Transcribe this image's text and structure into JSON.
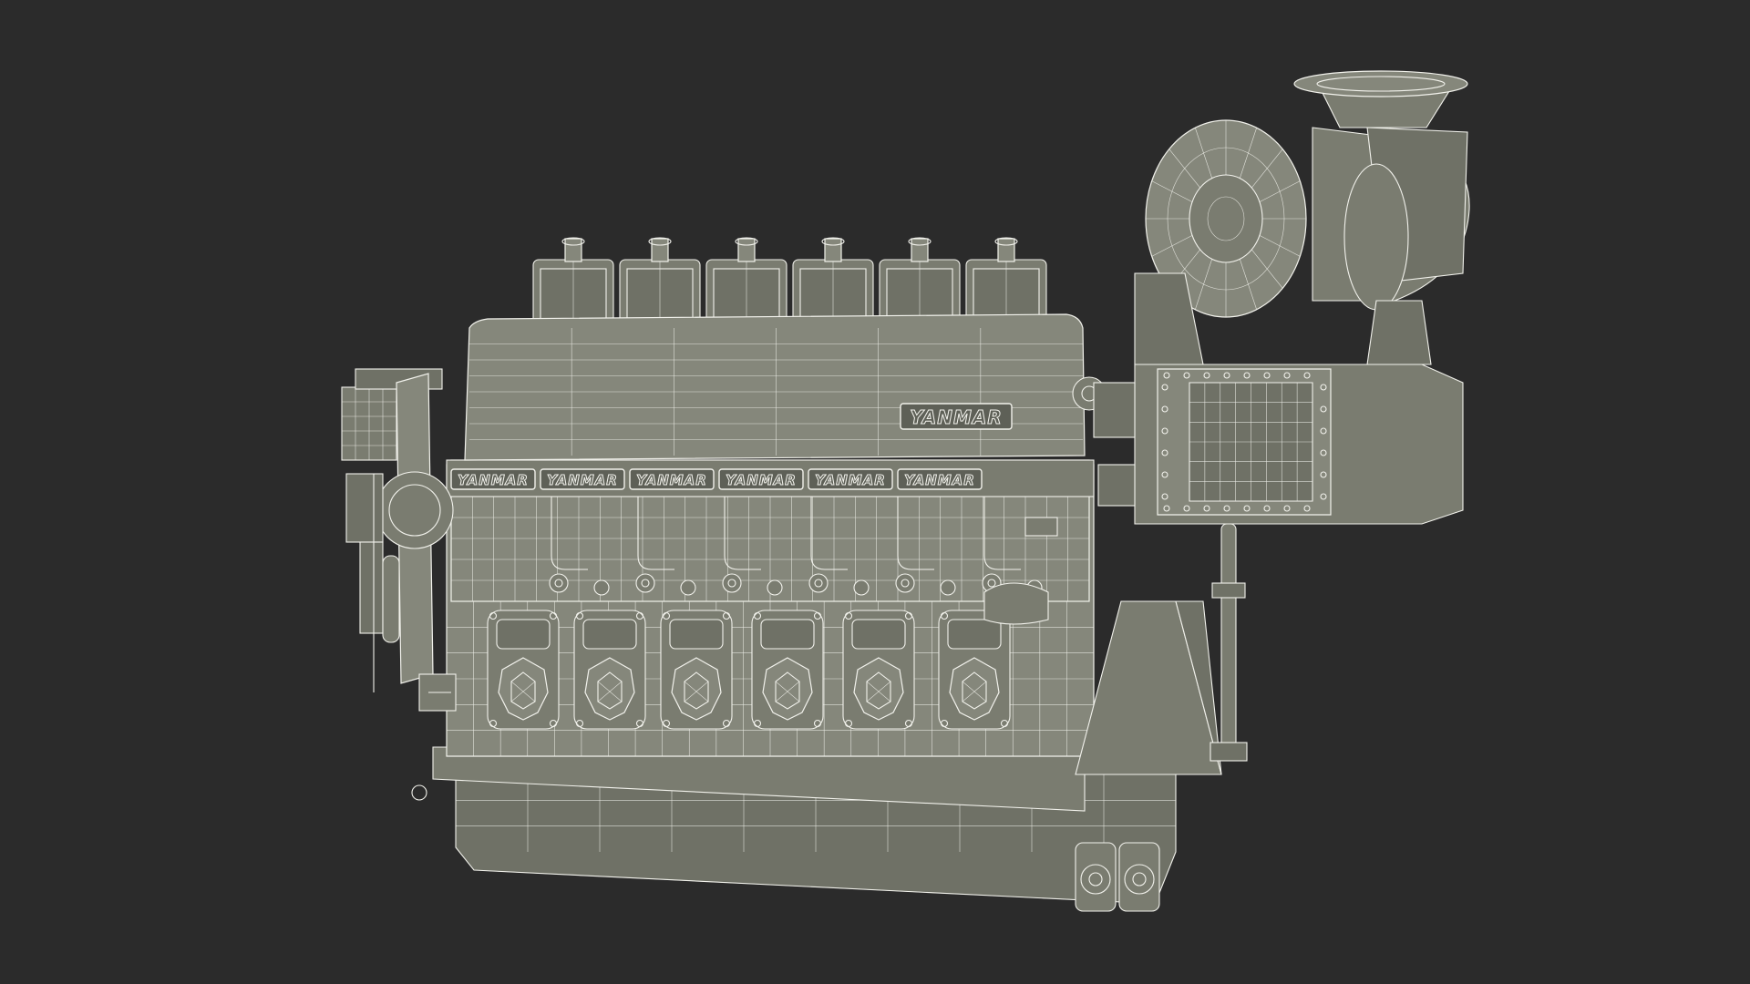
{
  "scene": {
    "background": "#2b2b2b",
    "model_color": "#85877b",
    "wire_color": "#f2f2ec"
  },
  "branding": {
    "main_logo": "YANMAR",
    "cylinder_logos": [
      "YANMAR",
      "YANMAR",
      "YANMAR",
      "YANMAR",
      "YANMAR",
      "YANMAR"
    ]
  }
}
